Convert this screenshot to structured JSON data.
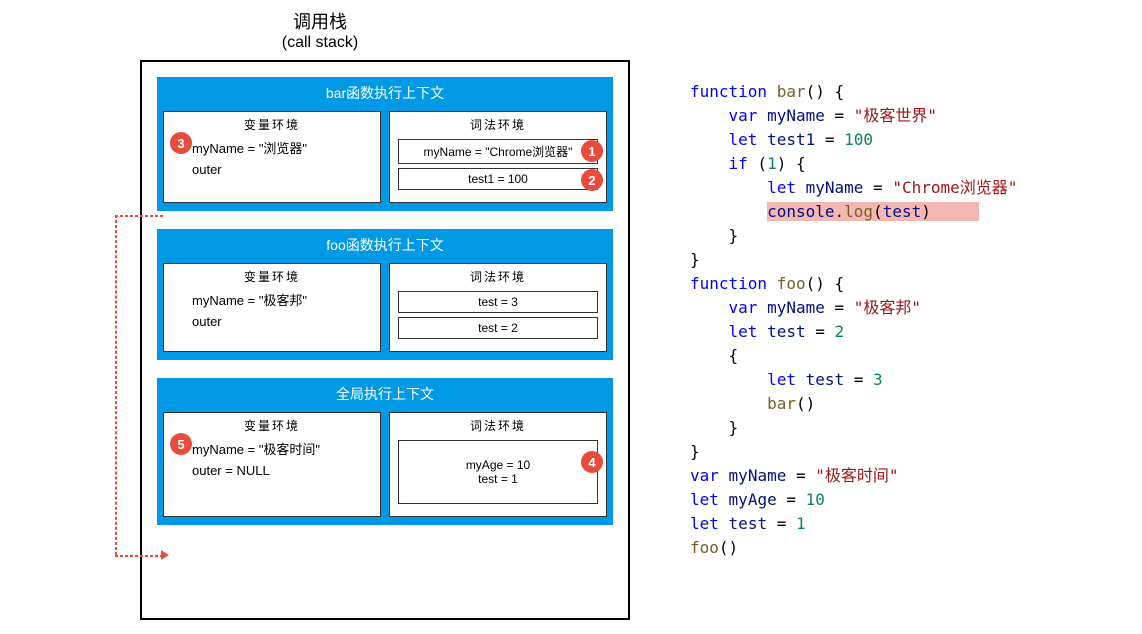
{
  "title": {
    "cn": "调用栈",
    "en": "(call stack)"
  },
  "stack": {
    "frames": [
      {
        "title": "bar函数执行上下文",
        "varEnv": {
          "label": "变量环境",
          "lines": [
            "myName = \"浏览器\"",
            "outer"
          ]
        },
        "lexEnv": {
          "label": "词法环境",
          "items": [
            "myName = \"Chrome浏览器\"",
            "test1 = 100"
          ]
        },
        "badges": {
          "varBadge": "3",
          "lexBadges": [
            "1",
            "2"
          ]
        }
      },
      {
        "title": "foo函数执行上下文",
        "varEnv": {
          "label": "变量环境",
          "lines": [
            "myName = \"极客邦\"",
            "outer"
          ]
        },
        "lexEnv": {
          "label": "词法环境",
          "items": [
            "test = 3",
            "test = 2"
          ]
        },
        "badges": {}
      },
      {
        "title": "全局执行上下文",
        "varEnv": {
          "label": "变量环境",
          "lines": [
            "myName = \"极客时间\"",
            "outer = NULL"
          ]
        },
        "lexEnv": {
          "label": "词法环境",
          "items": [
            "myAge = 10\ntest = 1"
          ]
        },
        "badges": {
          "varBadge": "5",
          "lexBadges": [
            "4"
          ]
        }
      }
    ]
  },
  "code": {
    "l1a": "function",
    "l1b": "bar",
    "l1c": "() {",
    "l2a": "var",
    "l2b": "myName",
    "l2c": " = ",
    "l2d": "\"极客世界\"",
    "l3a": "let",
    "l3b": "test1",
    "l3c": " = ",
    "l3d": "100",
    "l4a": "if",
    "l4b": " (",
    "l4c": "1",
    "l4d": ") {",
    "l5a": "let",
    "l5b": "myName",
    "l5c": " = ",
    "l5d": "\"Chrome浏览器\"",
    "l6a": "console",
    "l6b": ".",
    "l6c": "log",
    "l6d": "(",
    "l6e": "test",
    "l6f": ")",
    "l7": "    }",
    "l8": "}",
    "l9a": "function",
    "l9b": "foo",
    "l9c": "() {",
    "l10a": "var",
    "l10b": "myName",
    "l10c": " = ",
    "l10d": "\"极客邦\"",
    "l11a": "let",
    "l11b": "test",
    "l11c": " = ",
    "l11d": "2",
    "l12": "    {",
    "l13a": "let",
    "l13b": "test",
    "l13c": " = ",
    "l13d": "3",
    "l14a": "bar",
    "l14b": "()",
    "l15": "    }",
    "l16": "}",
    "l17a": "var",
    "l17b": "myName",
    "l17c": " = ",
    "l17d": "\"极客时间\"",
    "l18a": "let",
    "l18b": "myAge",
    "l18c": " = ",
    "l18d": "10",
    "l19a": "let",
    "l19b": "test",
    "l19c": " = ",
    "l19d": "1",
    "l20a": "foo",
    "l20b": "()"
  }
}
